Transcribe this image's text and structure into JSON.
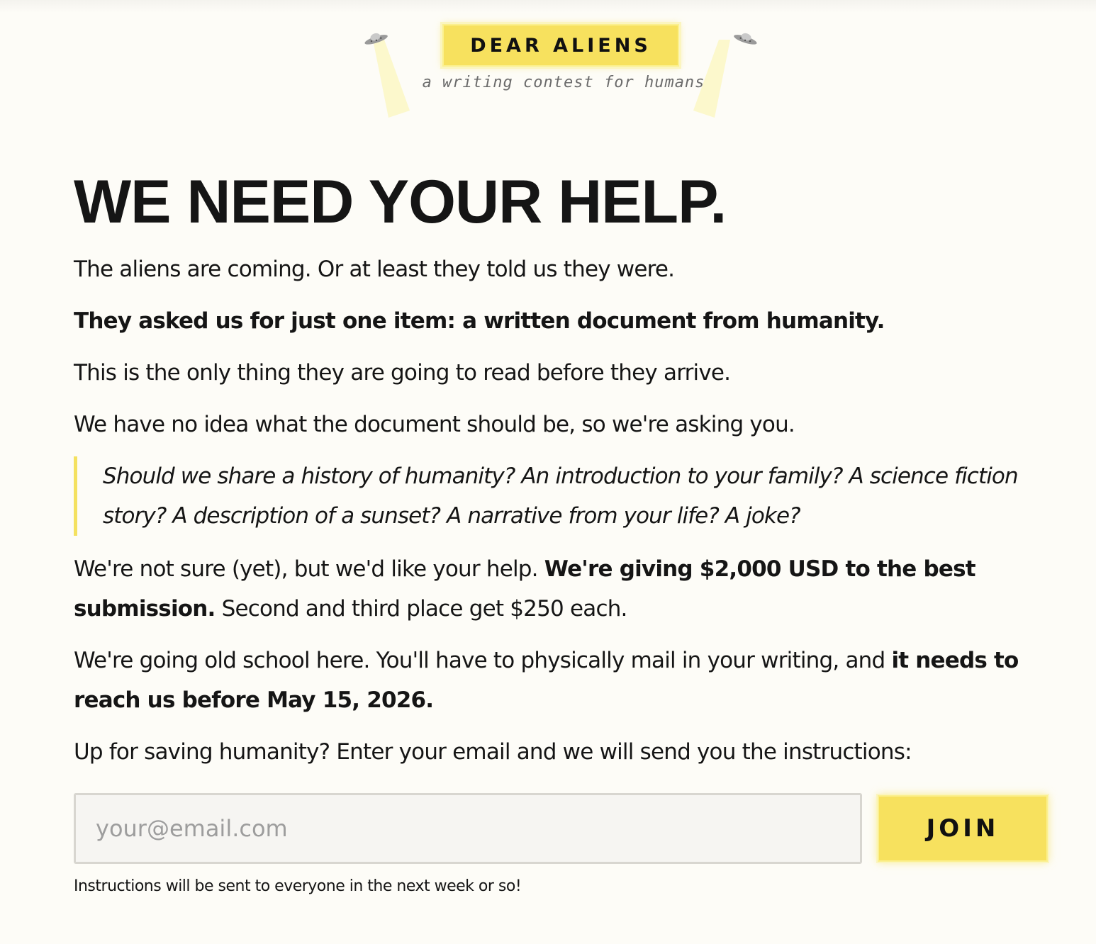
{
  "header": {
    "brand": "DEAR ALIENS",
    "tagline": "a writing contest for humans",
    "icons": [
      "ufo-icon",
      "ufo-icon"
    ]
  },
  "main": {
    "headline": "WE NEED YOUR HELP.",
    "p1": "The aliens are coming. Or at least they told us they were.",
    "p2": "They asked us for just one item: a written document from humanity.",
    "p3": "This is the only thing they are going to read before they arrive.",
    "p4": "We have no idea what the document should be, so we're asking you.",
    "quote": "Should we share a history of humanity? An introduction to your family? A science fiction story? A description of a sunset? A narrative from your life? A joke?",
    "p5": {
      "lead": "We're not sure (yet), but we'd like your help. ",
      "bold": "We're giving $2,000 USD to the best submission.",
      "tail": " Second and third place get $250 each."
    },
    "p6": {
      "lead": "We're going old school here. You'll have to physically mail in your writing, and ",
      "bold": "it needs to reach us before May 15, 2026."
    },
    "p7": "Up for saving humanity? Enter your email and we will send you the instructions:"
  },
  "form": {
    "email_value": "",
    "email_placeholder": "your@email.com",
    "join_label": "JOIN",
    "note": "Instructions will be sent to everyone in the next week or so!"
  },
  "colors": {
    "accent": "#f7e15e",
    "background": "#fdfcf7",
    "text": "#151515",
    "quote_border": "#f4e160"
  }
}
